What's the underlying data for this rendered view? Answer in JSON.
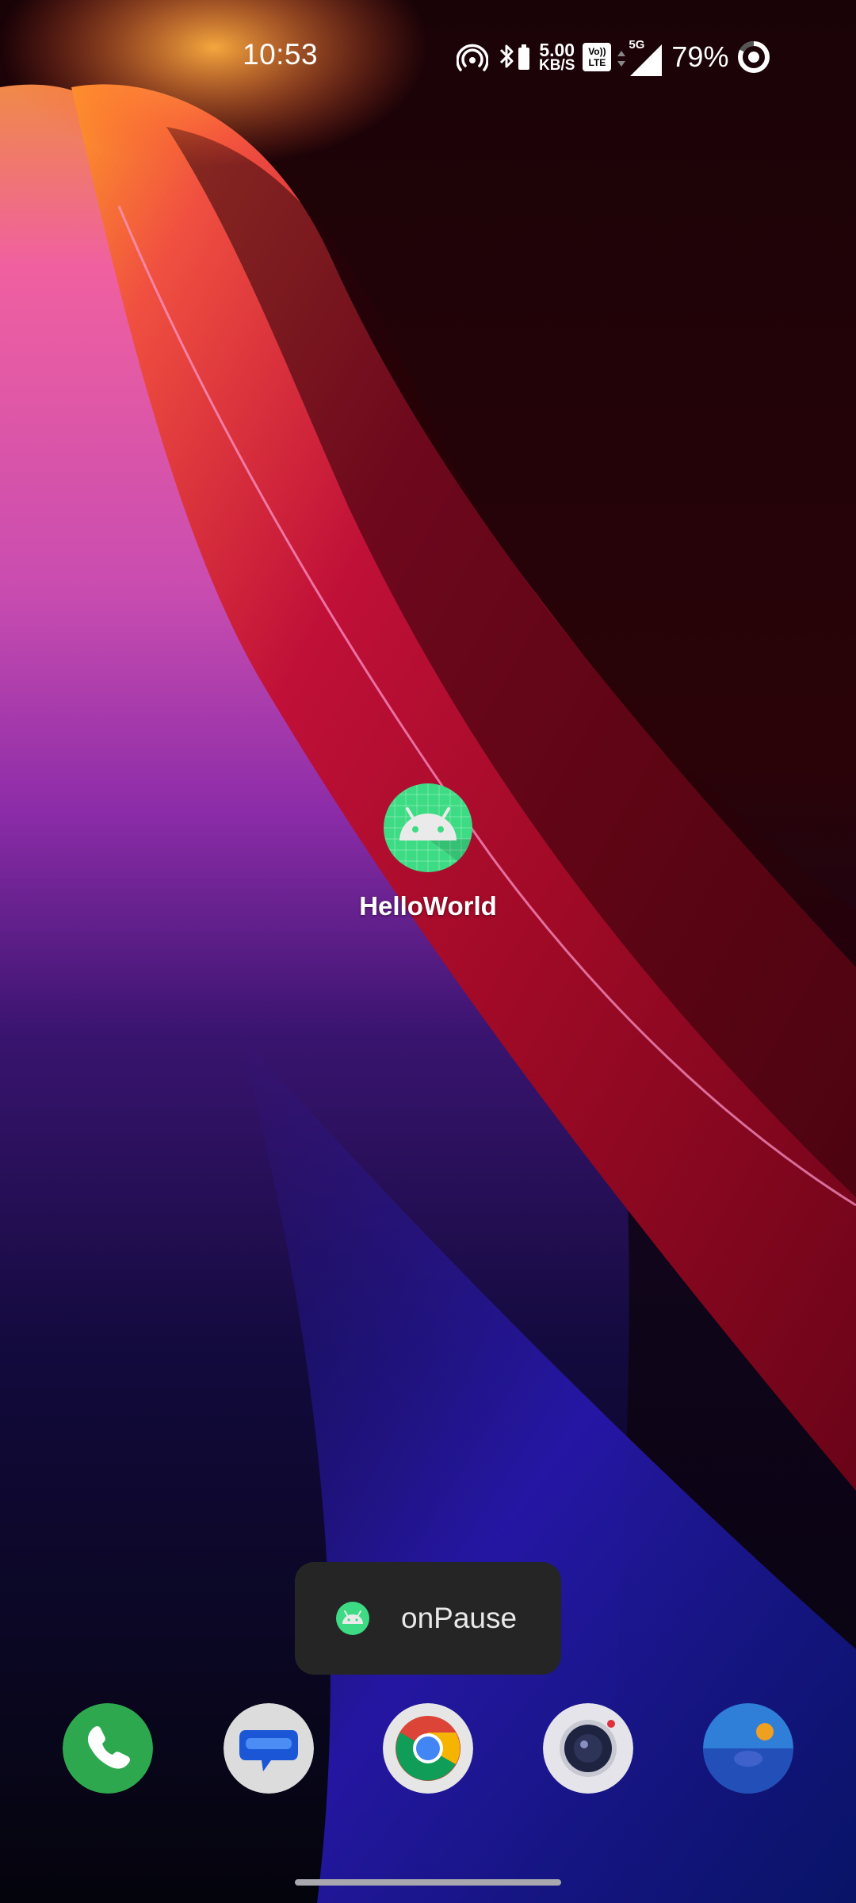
{
  "status_bar": {
    "time": "10:53",
    "net_speed_value": "5.00",
    "net_speed_unit": "KB/S",
    "volte_line1": "Vo))",
    "volte_line2": "LTE",
    "network_type": "5G",
    "battery_percent": "79%",
    "icons": [
      "hotspot-icon",
      "bluetooth-battery-icon",
      "volte-icon",
      "signal-icon",
      "battery-ring-icon"
    ]
  },
  "home": {
    "app_label": "HelloWorld",
    "app_icon": "android-robot-icon"
  },
  "toast": {
    "text": "onPause",
    "icon": "android-robot-icon"
  },
  "dock": {
    "apps": [
      "phone-icon",
      "messages-icon",
      "chrome-icon",
      "camera-icon",
      "gallery-icon"
    ]
  },
  "colors": {
    "app_icon_green": "#3ddc84",
    "toast_bg": "#252525",
    "phone_green": "#2ea84f",
    "messages_blue": "#1a56d6",
    "gallery_blue": "#2f7ed8"
  }
}
